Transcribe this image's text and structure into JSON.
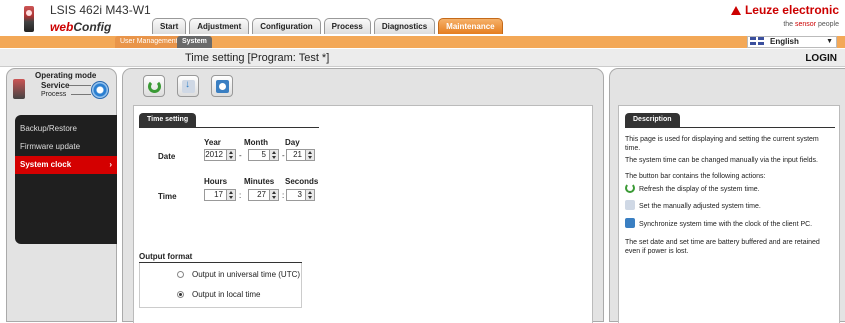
{
  "header": {
    "device_name": "LSIS 462i M43-W1",
    "brand_prefix": "web",
    "brand_suffix": "Config",
    "company": "Leuze electronic",
    "tagline_prefix": "the ",
    "tagline_accent": "sensor",
    "tagline_suffix": " people",
    "language": "English"
  },
  "tabs": [
    {
      "label": "Start"
    },
    {
      "label": "Adjustment"
    },
    {
      "label": "Configuration"
    },
    {
      "label": "Process"
    },
    {
      "label": "Diagnostics"
    },
    {
      "label": "Maintenance"
    }
  ],
  "subtabs": {
    "user_management": "User Management",
    "system": "System"
  },
  "title_bar": {
    "title": "Time setting   [Program: Test *]",
    "login": "LOGIN"
  },
  "operating_mode": {
    "title": "Operating mode",
    "service": "Service",
    "process": "Process"
  },
  "nav": [
    {
      "label": "Backup/Restore"
    },
    {
      "label": "Firmware update"
    },
    {
      "label": "System clock",
      "arrow": "›"
    }
  ],
  "time_setting": {
    "section_title": "Time setting",
    "date": {
      "label": "Date",
      "year_label": "Year",
      "month_label": "Month",
      "day_label": "Day",
      "year": "2012",
      "month": "5",
      "day": "21",
      "sep": "-"
    },
    "time": {
      "label": "Time",
      "hours_label": "Hours",
      "minutes_label": "Minutes",
      "seconds_label": "Seconds",
      "hours": "17",
      "minutes": "27",
      "seconds": "3",
      "sep": ":"
    },
    "output_format": {
      "title": "Output format",
      "options": [
        {
          "label": "Output in universal time (UTC)",
          "selected": false
        },
        {
          "label": "Output in local time",
          "selected": true
        }
      ]
    }
  },
  "description": {
    "tab": "Description",
    "p1": "This page is used for displaying and setting the current system time.",
    "p2": "The system time can be changed manually via the input fields.",
    "p3": "The button bar contains the following actions:",
    "actions": [
      {
        "icon": "refresh-icon",
        "text": "Refresh the display of the system time."
      },
      {
        "icon": "set-time-icon",
        "text": "Set the manually adjusted system time."
      },
      {
        "icon": "sync-icon",
        "text": "Synchronize system time with the clock of the client PC."
      }
    ],
    "p4": "The set date and set time are battery buffered and are retained even if power is lost."
  },
  "colors": {
    "accent": "#e57d1f",
    "brand_red": "#cc0000",
    "nav_active": "#d40000"
  }
}
